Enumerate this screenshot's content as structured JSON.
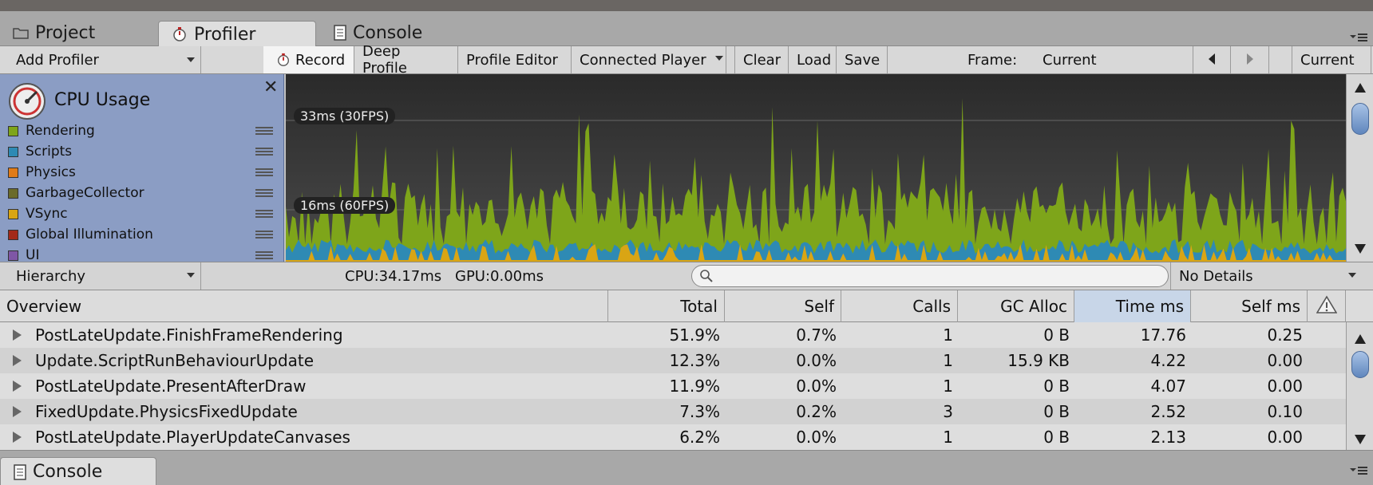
{
  "tabs": [
    {
      "label": "Project",
      "icon": "folder-icon"
    },
    {
      "label": "Profiler",
      "icon": "stopwatch-icon"
    },
    {
      "label": "Console",
      "icon": "console-icon"
    }
  ],
  "toolbar": {
    "add_profiler": "Add Profiler",
    "record": "Record",
    "deep_profile": "Deep Profile",
    "profile_editor": "Profile Editor",
    "connected_player": "Connected Player",
    "clear": "Clear",
    "load": "Load",
    "save": "Save",
    "frame_label": "Frame:",
    "frame_value": "Current",
    "current_button": "Current"
  },
  "legend": {
    "title": "CPU Usage",
    "items": [
      {
        "label": "Rendering",
        "color": "#7ea51a"
      },
      {
        "label": "Scripts",
        "color": "#2e8ab4"
      },
      {
        "label": "Physics",
        "color": "#e07b18"
      },
      {
        "label": "GarbageCollector",
        "color": "#6b6b2a"
      },
      {
        "label": "VSync",
        "color": "#d9a514"
      },
      {
        "label": "Global Illumination",
        "color": "#a32a1a"
      },
      {
        "label": "UI",
        "color": "#7f57a6"
      }
    ]
  },
  "graph": {
    "label_33": "33ms (30FPS)",
    "label_16": "16ms (60FPS)"
  },
  "hierarchy_bar": {
    "view_select": "Hierarchy",
    "cpu": "CPU:34.17ms",
    "gpu": "GPU:0.00ms",
    "search_placeholder": "",
    "details_select": "No Details"
  },
  "table": {
    "columns": [
      "Overview",
      "Total",
      "Self",
      "Calls",
      "GC Alloc",
      "Time ms",
      "Self ms"
    ],
    "sorted_column": "Time ms",
    "rows": [
      {
        "name": "PostLateUpdate.FinishFrameRendering",
        "total": "51.9%",
        "self": "0.7%",
        "calls": "1",
        "gc": "0 B",
        "time": "17.76",
        "selfms": "0.25"
      },
      {
        "name": "Update.ScriptRunBehaviourUpdate",
        "total": "12.3%",
        "self": "0.0%",
        "calls": "1",
        "gc": "15.9 KB",
        "time": "4.22",
        "selfms": "0.00"
      },
      {
        "name": "PostLateUpdate.PresentAfterDraw",
        "total": "11.9%",
        "self": "0.0%",
        "calls": "1",
        "gc": "0 B",
        "time": "4.07",
        "selfms": "0.00"
      },
      {
        "name": "FixedUpdate.PhysicsFixedUpdate",
        "total": "7.3%",
        "self": "0.2%",
        "calls": "3",
        "gc": "0 B",
        "time": "2.52",
        "selfms": "0.10"
      },
      {
        "name": "PostLateUpdate.PlayerUpdateCanvases",
        "total": "6.2%",
        "self": "0.0%",
        "calls": "1",
        "gc": "0 B",
        "time": "2.13",
        "selfms": "0.00"
      }
    ]
  },
  "bottom_tab": {
    "label": "Console",
    "icon": "console-icon"
  }
}
